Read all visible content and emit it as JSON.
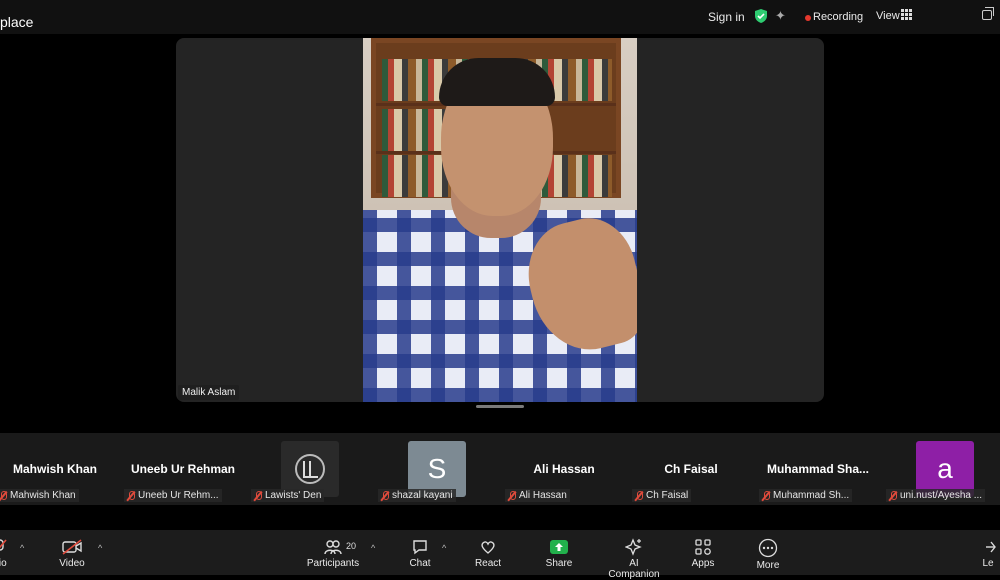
{
  "window": {
    "title": "place"
  },
  "header": {
    "signin_label": "Sign in",
    "recording_label": "Recording",
    "view_label": "View",
    "icons": [
      "shield-check-icon",
      "sparkle-icon",
      "grid-icon",
      "restore-window-icon"
    ]
  },
  "main": {
    "speaker_name": "Malik Aslam"
  },
  "participants_strip": [
    {
      "display": "Mahwish Khan",
      "label": "Mahwish Khan",
      "type": "name"
    },
    {
      "display": "Uneeb Ur Rehman",
      "label": "Uneeb Ur Rehm...",
      "type": "name"
    },
    {
      "display": "",
      "label": "Lawists' Den",
      "type": "logo"
    },
    {
      "display": "S",
      "label": "shazal kayani",
      "type": "avatar",
      "color": "#7d8a93"
    },
    {
      "display": "Ali Hassan",
      "label": "Ali Hassan",
      "type": "name"
    },
    {
      "display": "Ch Faisal",
      "label": "Ch Faisal",
      "type": "name"
    },
    {
      "display": "Muhammad  Sha...",
      "label": "Muhammad Sh...",
      "type": "name"
    },
    {
      "display": "a",
      "label": "uni.nust/Ayesha ...",
      "type": "avatar",
      "color": "#8e1fa6"
    }
  ],
  "toolbar": {
    "audio_label": "dio",
    "video_label": "Video",
    "participants_label": "Participants",
    "participants_count": "20",
    "chat_label": "Chat",
    "react_label": "React",
    "share_label": "Share",
    "ai_label": "AI Companion",
    "apps_label": "Apps",
    "more_label": "More",
    "leave_label": "Le"
  },
  "colors": {
    "share_green": "#22b14c",
    "recording_red": "#e5382d",
    "shield_green": "#2ecc71"
  }
}
